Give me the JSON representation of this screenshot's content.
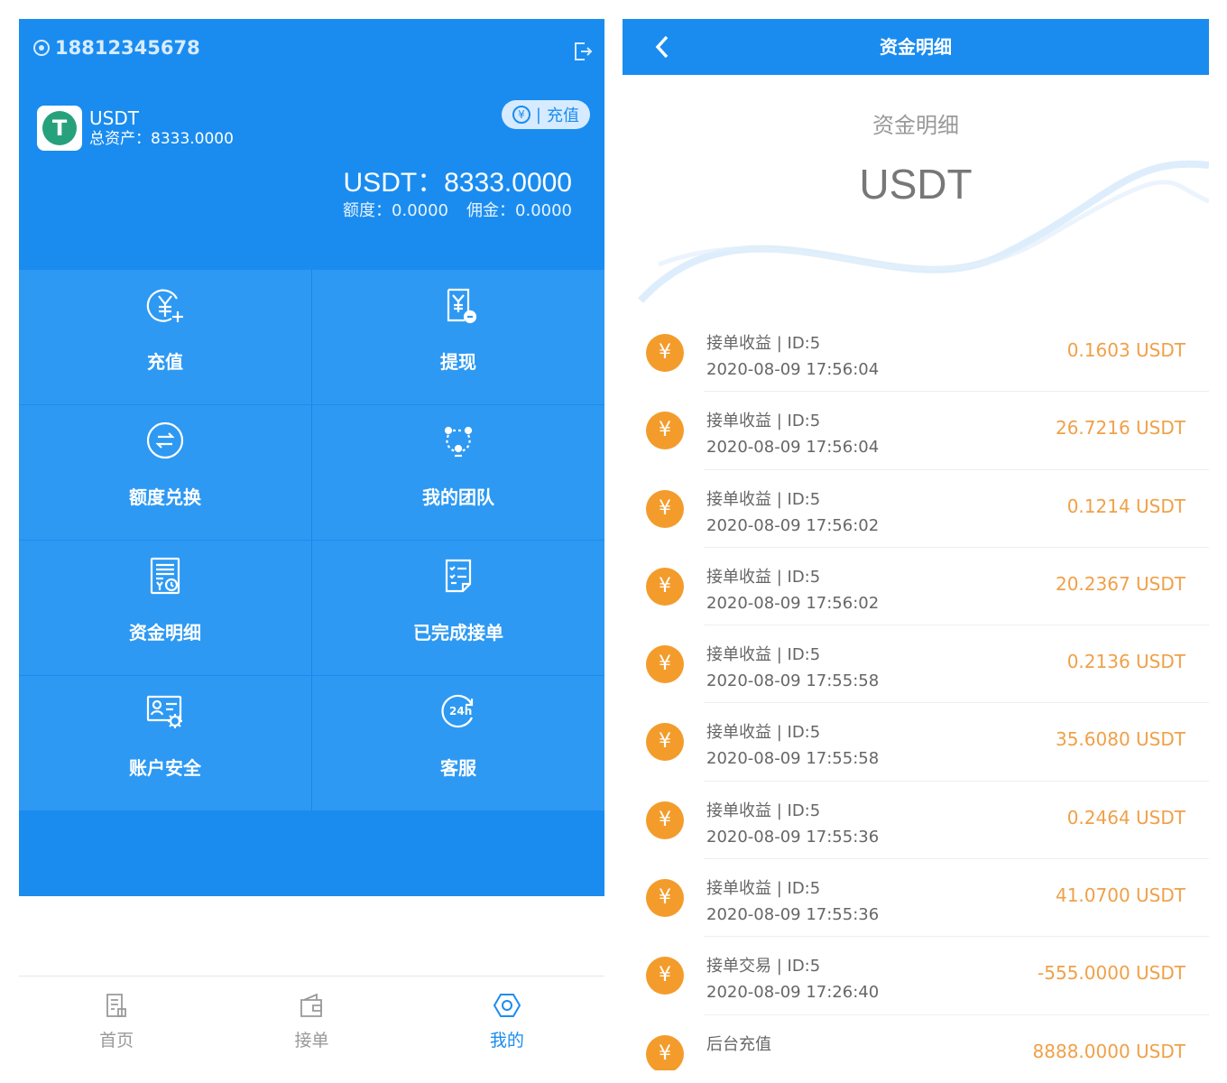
{
  "left": {
    "phone": "18812345678",
    "coin_name": "USDT",
    "total_assets": "总资产：8333.0000",
    "recharge_button": "充值",
    "balance": "USDT：8333.0000",
    "quota": "额度：0.0000",
    "commission": "佣金：0.0000",
    "menu": [
      {
        "label": "充值",
        "icon": "yen-plus-icon"
      },
      {
        "label": "提现",
        "icon": "withdraw-icon"
      },
      {
        "label": "额度兑换",
        "icon": "exchange-icon"
      },
      {
        "label": "我的团队",
        "icon": "team-icon"
      },
      {
        "label": "资金明细",
        "icon": "ledger-icon"
      },
      {
        "label": "已完成接单",
        "icon": "checklist-icon"
      },
      {
        "label": "账户安全",
        "icon": "account-security-icon"
      },
      {
        "label": "客服",
        "icon": "24h-service-icon"
      }
    ],
    "tabs": [
      {
        "label": "首页",
        "icon": "home-icon"
      },
      {
        "label": "接单",
        "icon": "wallet-icon"
      },
      {
        "label": "我的",
        "icon": "hexagon-icon",
        "active": true
      }
    ]
  },
  "right": {
    "nav_title": "资金明细",
    "hero_subtitle": "资金明细",
    "hero_coin": "USDT",
    "records": [
      {
        "title": "接单收益 | ID:5",
        "time": "2020-08-09 17:56:04",
        "amount": "0.1603 USDT"
      },
      {
        "title": "接单收益 | ID:5",
        "time": "2020-08-09 17:56:04",
        "amount": "26.7216 USDT"
      },
      {
        "title": "接单收益 | ID:5",
        "time": "2020-08-09 17:56:02",
        "amount": "0.1214 USDT"
      },
      {
        "title": "接单收益 | ID:5",
        "time": "2020-08-09 17:56:02",
        "amount": "20.2367 USDT"
      },
      {
        "title": "接单收益 | ID:5",
        "time": "2020-08-09 17:55:58",
        "amount": "0.2136 USDT"
      },
      {
        "title": "接单收益 | ID:5",
        "time": "2020-08-09 17:55:58",
        "amount": "35.6080 USDT"
      },
      {
        "title": "接单收益 | ID:5",
        "time": "2020-08-09 17:55:36",
        "amount": "0.2464 USDT"
      },
      {
        "title": "接单收益 | ID:5",
        "time": "2020-08-09 17:55:36",
        "amount": "41.0700 USDT"
      },
      {
        "title": "接单交易 | ID:5",
        "time": "2020-08-09 17:26:40",
        "amount": "-555.0000 USDT"
      },
      {
        "title": "后台充值",
        "time": "",
        "amount": "8888.0000 USDT"
      }
    ],
    "record_badge_symbol": "¥"
  },
  "colors": {
    "primary_blue": "#1a8cf0",
    "cell_blue": "#2d99f3",
    "amount_orange": "#f0a048",
    "badge_orange": "#f39c2c"
  }
}
